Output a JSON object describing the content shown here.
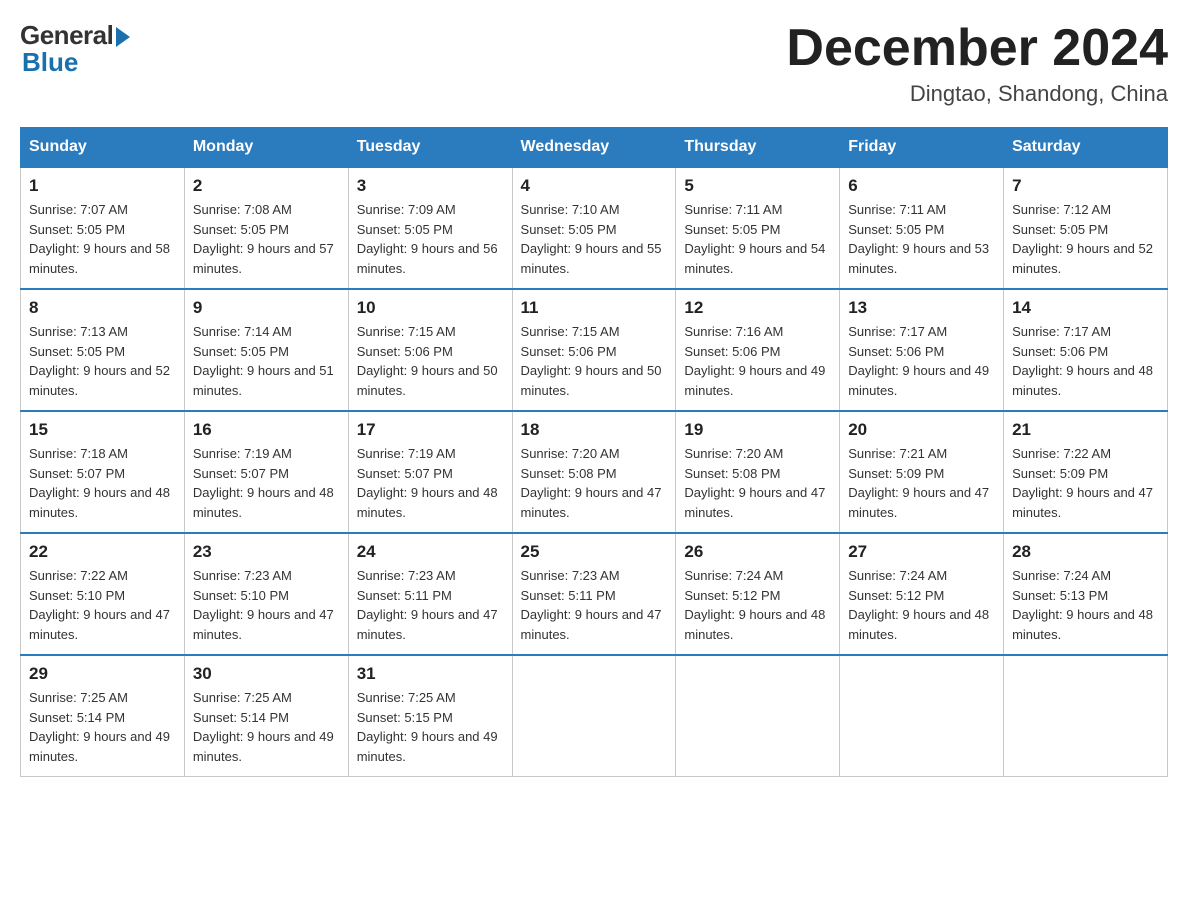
{
  "header": {
    "logo": {
      "general_text": "General",
      "blue_text": "Blue"
    },
    "month_year": "December 2024",
    "location": "Dingtao, Shandong, China"
  },
  "weekdays": [
    "Sunday",
    "Monday",
    "Tuesday",
    "Wednesday",
    "Thursday",
    "Friday",
    "Saturday"
  ],
  "weeks": [
    [
      {
        "day": "1",
        "sunrise": "7:07 AM",
        "sunset": "5:05 PM",
        "daylight": "9 hours and 58 minutes."
      },
      {
        "day": "2",
        "sunrise": "7:08 AM",
        "sunset": "5:05 PM",
        "daylight": "9 hours and 57 minutes."
      },
      {
        "day": "3",
        "sunrise": "7:09 AM",
        "sunset": "5:05 PM",
        "daylight": "9 hours and 56 minutes."
      },
      {
        "day": "4",
        "sunrise": "7:10 AM",
        "sunset": "5:05 PM",
        "daylight": "9 hours and 55 minutes."
      },
      {
        "day": "5",
        "sunrise": "7:11 AM",
        "sunset": "5:05 PM",
        "daylight": "9 hours and 54 minutes."
      },
      {
        "day": "6",
        "sunrise": "7:11 AM",
        "sunset": "5:05 PM",
        "daylight": "9 hours and 53 minutes."
      },
      {
        "day": "7",
        "sunrise": "7:12 AM",
        "sunset": "5:05 PM",
        "daylight": "9 hours and 52 minutes."
      }
    ],
    [
      {
        "day": "8",
        "sunrise": "7:13 AM",
        "sunset": "5:05 PM",
        "daylight": "9 hours and 52 minutes."
      },
      {
        "day": "9",
        "sunrise": "7:14 AM",
        "sunset": "5:05 PM",
        "daylight": "9 hours and 51 minutes."
      },
      {
        "day": "10",
        "sunrise": "7:15 AM",
        "sunset": "5:06 PM",
        "daylight": "9 hours and 50 minutes."
      },
      {
        "day": "11",
        "sunrise": "7:15 AM",
        "sunset": "5:06 PM",
        "daylight": "9 hours and 50 minutes."
      },
      {
        "day": "12",
        "sunrise": "7:16 AM",
        "sunset": "5:06 PM",
        "daylight": "9 hours and 49 minutes."
      },
      {
        "day": "13",
        "sunrise": "7:17 AM",
        "sunset": "5:06 PM",
        "daylight": "9 hours and 49 minutes."
      },
      {
        "day": "14",
        "sunrise": "7:17 AM",
        "sunset": "5:06 PM",
        "daylight": "9 hours and 48 minutes."
      }
    ],
    [
      {
        "day": "15",
        "sunrise": "7:18 AM",
        "sunset": "5:07 PM",
        "daylight": "9 hours and 48 minutes."
      },
      {
        "day": "16",
        "sunrise": "7:19 AM",
        "sunset": "5:07 PM",
        "daylight": "9 hours and 48 minutes."
      },
      {
        "day": "17",
        "sunrise": "7:19 AM",
        "sunset": "5:07 PM",
        "daylight": "9 hours and 48 minutes."
      },
      {
        "day": "18",
        "sunrise": "7:20 AM",
        "sunset": "5:08 PM",
        "daylight": "9 hours and 47 minutes."
      },
      {
        "day": "19",
        "sunrise": "7:20 AM",
        "sunset": "5:08 PM",
        "daylight": "9 hours and 47 minutes."
      },
      {
        "day": "20",
        "sunrise": "7:21 AM",
        "sunset": "5:09 PM",
        "daylight": "9 hours and 47 minutes."
      },
      {
        "day": "21",
        "sunrise": "7:22 AM",
        "sunset": "5:09 PM",
        "daylight": "9 hours and 47 minutes."
      }
    ],
    [
      {
        "day": "22",
        "sunrise": "7:22 AM",
        "sunset": "5:10 PM",
        "daylight": "9 hours and 47 minutes."
      },
      {
        "day": "23",
        "sunrise": "7:23 AM",
        "sunset": "5:10 PM",
        "daylight": "9 hours and 47 minutes."
      },
      {
        "day": "24",
        "sunrise": "7:23 AM",
        "sunset": "5:11 PM",
        "daylight": "9 hours and 47 minutes."
      },
      {
        "day": "25",
        "sunrise": "7:23 AM",
        "sunset": "5:11 PM",
        "daylight": "9 hours and 47 minutes."
      },
      {
        "day": "26",
        "sunrise": "7:24 AM",
        "sunset": "5:12 PM",
        "daylight": "9 hours and 48 minutes."
      },
      {
        "day": "27",
        "sunrise": "7:24 AM",
        "sunset": "5:12 PM",
        "daylight": "9 hours and 48 minutes."
      },
      {
        "day": "28",
        "sunrise": "7:24 AM",
        "sunset": "5:13 PM",
        "daylight": "9 hours and 48 minutes."
      }
    ],
    [
      {
        "day": "29",
        "sunrise": "7:25 AM",
        "sunset": "5:14 PM",
        "daylight": "9 hours and 49 minutes."
      },
      {
        "day": "30",
        "sunrise": "7:25 AM",
        "sunset": "5:14 PM",
        "daylight": "9 hours and 49 minutes."
      },
      {
        "day": "31",
        "sunrise": "7:25 AM",
        "sunset": "5:15 PM",
        "daylight": "9 hours and 49 minutes."
      },
      null,
      null,
      null,
      null
    ]
  ]
}
